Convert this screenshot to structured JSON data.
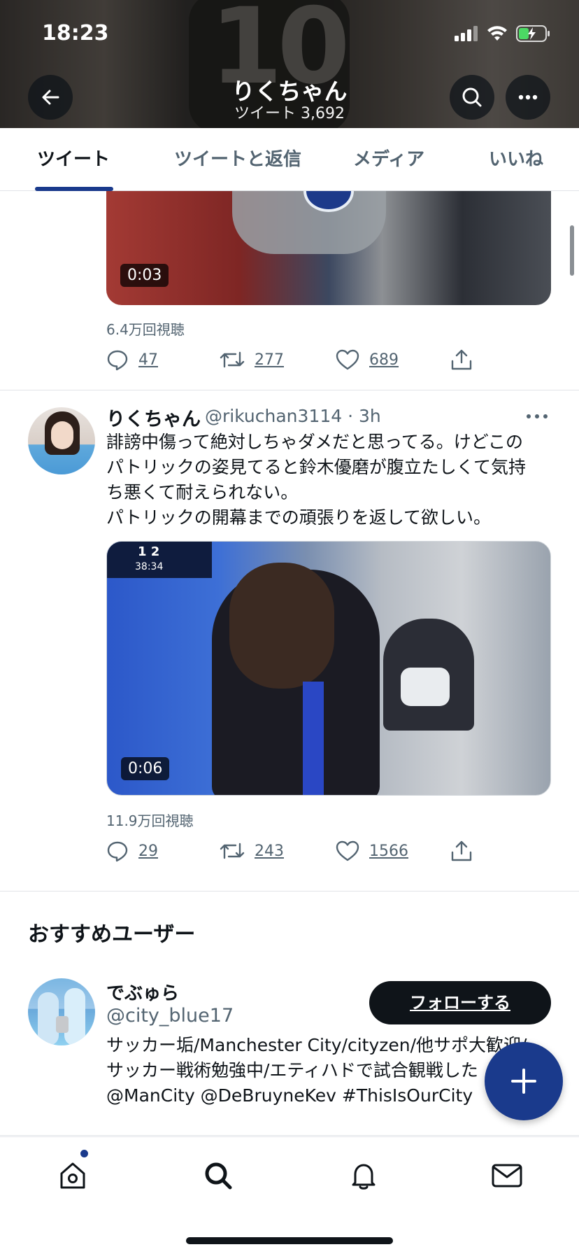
{
  "status_bar": {
    "time": "18:23"
  },
  "header": {
    "title": "りくちゃん",
    "subtitle": "ツイート 3,692",
    "back_icon": "arrow-left-icon",
    "search_icon": "search-icon",
    "more_icon": "ellipsis-icon"
  },
  "tabs": [
    {
      "label": "ツイート",
      "active": true
    },
    {
      "label": "ツイートと返信",
      "active": false
    },
    {
      "label": "メディア",
      "active": false
    },
    {
      "label": "いいね",
      "active": false
    }
  ],
  "tweet1": {
    "video_duration": "0:03",
    "views": "6.4万回視聴",
    "replies": "47",
    "retweets": "277",
    "likes": "689"
  },
  "tweet2": {
    "name": "りくちゃん",
    "handle_time": "@rikuchan3114 · 3h",
    "text_line1": "誹謗中傷って絶対しちゃダメだと思ってる。けどこの",
    "text_line2": "パトリックの姿見てると鈴木優磨が腹立たしくて気持",
    "text_line3": "ち悪くて耐えられない。",
    "text_line4": "パトリックの開幕までの頑張りを返して欲しい。",
    "video_score": "1 2",
    "video_clock": "38:34",
    "video_duration": "0:06",
    "views": "11.9万回視聴",
    "replies": "29",
    "retweets": "243",
    "likes": "1566"
  },
  "recommended": {
    "title": "おすすめユーザー",
    "users": [
      {
        "name": "でぶゅら",
        "handle": "@city_blue17",
        "follow_label": "フォローする",
        "bio_line1": "サッカー垢/Manchester City/cityzen/他サポ大歓迎/",
        "bio_line2": "サッカー戦術勉強中/エティハドで試合観戦した",
        "bio_line3": "@ManCity @DeBruyneKev #ThisIsOurCity"
      }
    ]
  },
  "fab": {
    "icon": "plus-icon"
  },
  "bottom_nav": {
    "items": [
      "home-icon",
      "search-icon",
      "bell-icon",
      "mail-icon"
    ],
    "home_has_notification": true
  },
  "colors": {
    "accent": "#1a3a8c",
    "text_primary": "#0f1419",
    "text_secondary": "#536471",
    "follow_button": "#0f1419"
  }
}
